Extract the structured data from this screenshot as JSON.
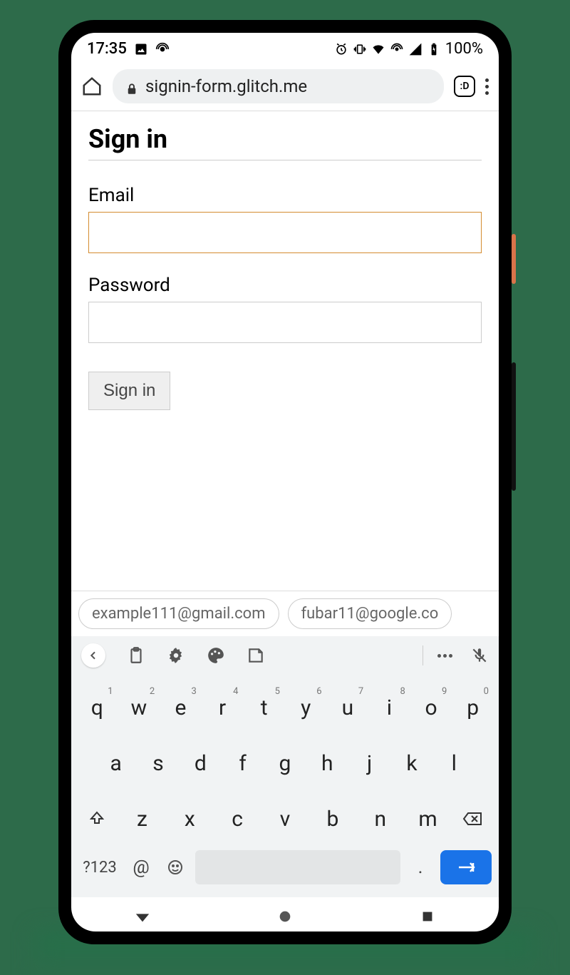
{
  "status": {
    "time": "17:35",
    "battery": "100%"
  },
  "browser": {
    "url": "signin-form.glitch.me",
    "tab_badge": ":D"
  },
  "page": {
    "title": "Sign in",
    "email_label": "Email",
    "password_label": "Password",
    "submit_label": "Sign in"
  },
  "suggestions": [
    "example111@gmail.com",
    "fubar11@google.co"
  ],
  "keyboard": {
    "row1": [
      "q",
      "w",
      "e",
      "r",
      "t",
      "y",
      "u",
      "i",
      "o",
      "p"
    ],
    "row1_sup": [
      "1",
      "2",
      "3",
      "4",
      "5",
      "6",
      "7",
      "8",
      "9",
      "0"
    ],
    "row2": [
      "a",
      "s",
      "d",
      "f",
      "g",
      "h",
      "j",
      "k",
      "l"
    ],
    "row3": [
      "z",
      "x",
      "c",
      "v",
      "b",
      "n",
      "m"
    ],
    "symbols_label": "?123",
    "at_label": "@",
    "period_label": "."
  }
}
